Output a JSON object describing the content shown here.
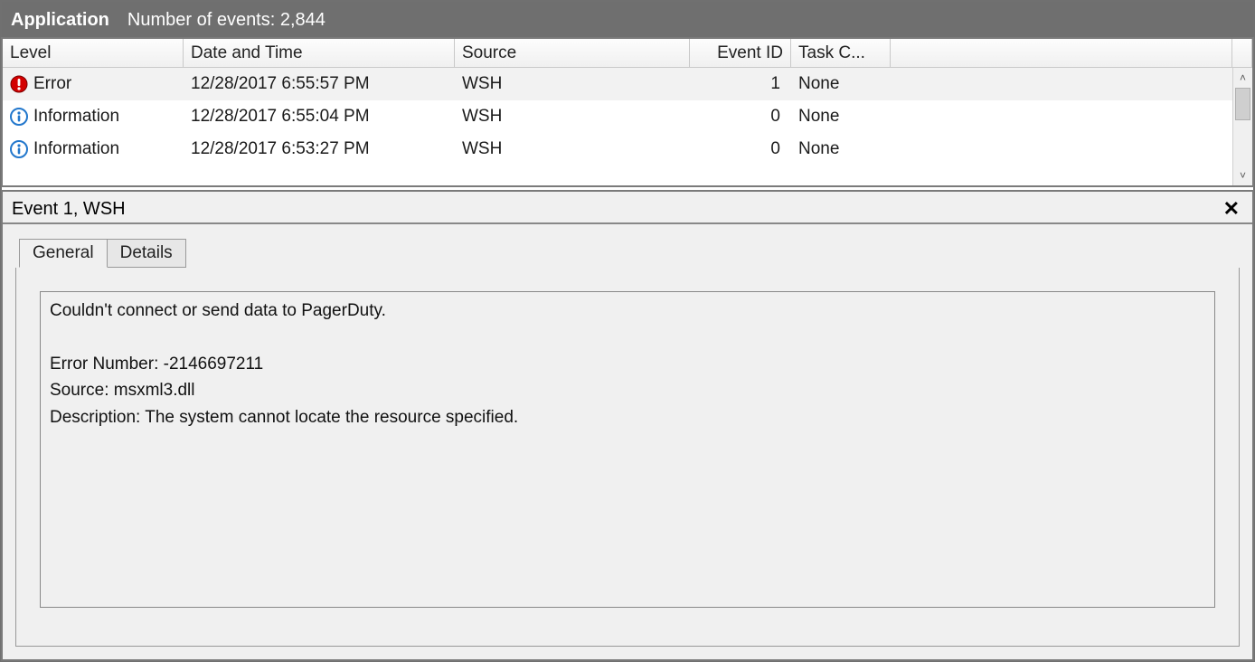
{
  "header": {
    "title": "Application",
    "subtitle": "Number of events: 2,844"
  },
  "grid": {
    "columns": {
      "level": "Level",
      "datetime": "Date and Time",
      "source": "Source",
      "eventid": "Event ID",
      "task": "Task C..."
    },
    "rows": [
      {
        "selected": true,
        "level_icon": "error",
        "level": "Error",
        "datetime": "12/28/2017 6:55:57 PM",
        "source": "WSH",
        "eventid": "1",
        "task": "None"
      },
      {
        "selected": false,
        "level_icon": "info",
        "level": "Information",
        "datetime": "12/28/2017 6:55:04 PM",
        "source": "WSH",
        "eventid": "0",
        "task": "None"
      },
      {
        "selected": false,
        "level_icon": "info",
        "level": "Information",
        "datetime": "12/28/2017 6:53:27 PM",
        "source": "WSH",
        "eventid": "0",
        "task": "None"
      }
    ]
  },
  "scroll": {
    "up_glyph": "˄",
    "down_glyph": "˅"
  },
  "detail": {
    "title": "Event 1, WSH",
    "close_glyph": "✕",
    "tabs": {
      "general": "General",
      "details": "Details"
    },
    "message": "Couldn't connect or send data to PagerDuty.\n\nError Number: -2146697211\nSource: msxml3.dll\nDescription: The system cannot locate the resource specified.\n"
  },
  "icons": {
    "error": {
      "fill": "#d30000",
      "inner": "#ffffff"
    },
    "info": {
      "fill": "#2277cc",
      "inner": "#ffffff"
    }
  }
}
